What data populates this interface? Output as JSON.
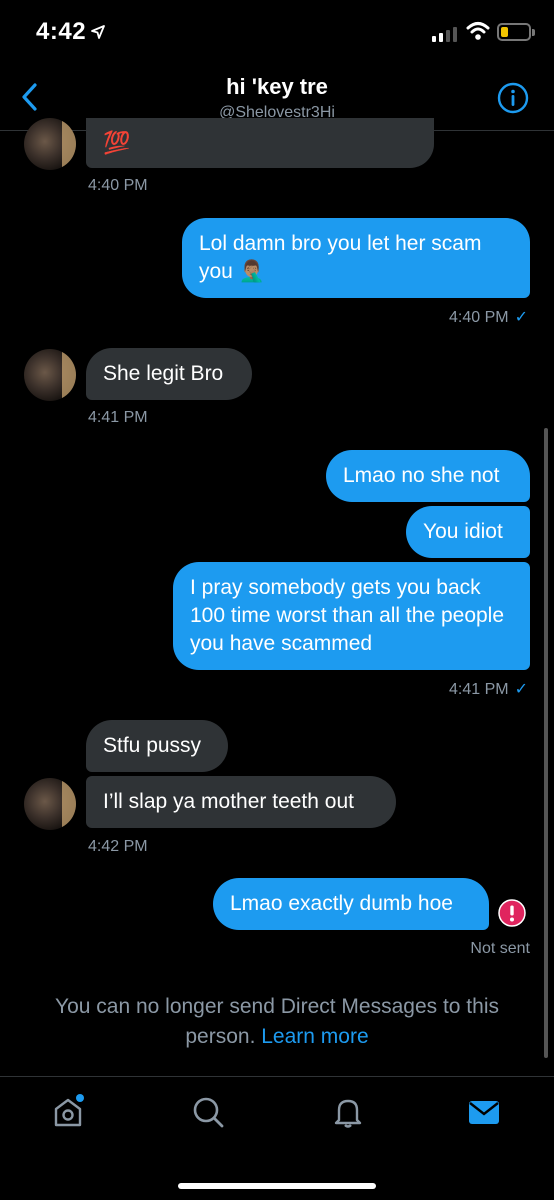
{
  "status_bar": {
    "time": "4:42"
  },
  "header": {
    "title": "hi 'key tre",
    "handle": "@Shelovestr3Hi"
  },
  "messages": {
    "m0": {
      "text": "💯"
    },
    "t0": "4:40 PM",
    "m1": {
      "text": "Lol damn bro you let her scam you 🤦🏽‍♂️"
    },
    "t1": "4:40 PM",
    "m2": {
      "text": "She legit Bro"
    },
    "t2": "4:41 PM",
    "m3": {
      "text": "Lmao no she not"
    },
    "m4": {
      "text": "You idiot"
    },
    "m5": {
      "text": "I pray somebody gets you back 100 time worst than all the people you have scammed"
    },
    "t5": "4:41 PM",
    "m6": {
      "text": "Stfu pussy"
    },
    "m7": {
      "text": "I’ll slap ya mother teeth out"
    },
    "t7": "4:42 PM",
    "m8": {
      "text": "Lmao exactly dumb hoe"
    },
    "t8": "Not sent"
  },
  "footer_note": {
    "text": "You can no longer send Direct Messages to this person.",
    "link": "Learn more"
  },
  "tabs": [
    "home-icon",
    "search-icon",
    "notifications-icon",
    "messages-icon"
  ],
  "colors": {
    "accent": "#1d9bf0",
    "received_bubble": "#2f3336",
    "error": "#e0245e"
  }
}
